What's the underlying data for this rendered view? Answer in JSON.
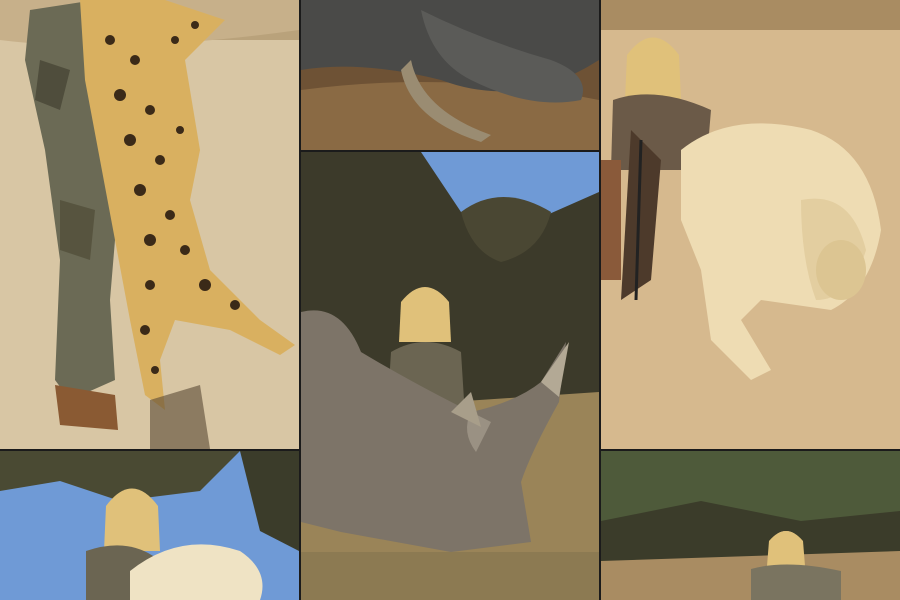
{
  "collage": {
    "tiles": [
      {
        "subject": "leopard"
      },
      {
        "subject": "elephant"
      },
      {
        "subject": "rhino"
      },
      {
        "subject": "lion"
      },
      {
        "subject": "white-lion"
      },
      {
        "subject": "hunter-in-bush"
      }
    ]
  },
  "colors": {
    "sand": "#d9c7a6",
    "sky": "#6f9ad6",
    "bush": "#3c3a2a",
    "grass": "#9a8458"
  }
}
